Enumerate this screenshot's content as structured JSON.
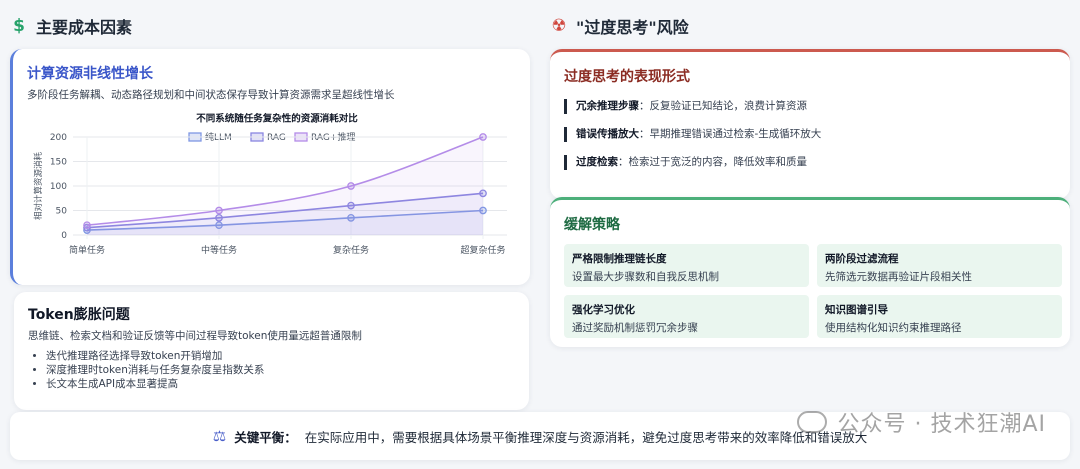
{
  "left": {
    "heading": "主要成本因素",
    "heading_icon": "dollar-icon",
    "compute_card": {
      "title": "计算资源非线性增长",
      "subtitle": "多阶段任务解耦、动态路径规划和中间状态保存导致计算资源需求呈超线性增长"
    },
    "token_card": {
      "title": "Token膨胀问题",
      "subtitle": "思维链、检索文档和验证反馈等中间过程导致token使用量远超普通限制",
      "bullets": [
        "迭代推理路径选择导致token开销增加",
        "深度推理时token消耗与任务复杂度呈指数关系",
        "长文本生成API成本显著提高"
      ]
    }
  },
  "right": {
    "heading": "\"过度思考\"风险",
    "heading_icon": "radiation-icon",
    "risk_card": {
      "title": "过度思考的表现形式",
      "items": [
        {
          "label": "冗余推理步骤",
          "sep": "：",
          "text": "反复验证已知结论，浪费计算资源"
        },
        {
          "label": "错误传播放大",
          "sep": "：",
          "text": "早期推理错误通过检索-生成循环放大"
        },
        {
          "label": "过度检索",
          "sep": "：",
          "text": "检索过于宽泛的内容，降低效率和质量"
        }
      ]
    },
    "mitigation_card": {
      "title": "缓解策略",
      "boxes": [
        {
          "title": "严格限制推理链长度",
          "desc": "设置最大步骤数和自我反思机制"
        },
        {
          "title": "两阶段过滤流程",
          "desc": "先筛选元数据再验证片段相关性"
        },
        {
          "title": "强化学习优化",
          "desc": "通过奖励机制惩罚冗余步骤"
        },
        {
          "title": "知识图谱引导",
          "desc": "使用结构化知识约束推理路径"
        }
      ]
    }
  },
  "bottom": {
    "icon": "balance-scale-icon",
    "label": "关键平衡：",
    "text": "在实际应用中，需要根据具体场景平衡推理深度与资源消耗，避免过度思考带来的效率降低和错误放大"
  },
  "watermark": {
    "text": "公众号 · 技术狂潮AI"
  },
  "colors": {
    "series_llm": "#7f97e3",
    "series_rag": "#8a86e0",
    "series_rag_reason": "#b48ce8"
  },
  "chart_data": {
    "type": "line",
    "title": "不同系统随任务复杂性的资源消耗对比",
    "xlabel": "",
    "ylabel": "相对计算资源消耗",
    "categories": [
      "简单任务",
      "中等任务",
      "复杂任务",
      "超复杂任务"
    ],
    "ylim": [
      0,
      200
    ],
    "yticks": [
      0,
      50,
      100,
      150,
      200
    ],
    "grid": true,
    "legend_position": "top-center",
    "series": [
      {
        "name": "纯LLM",
        "values": [
          10,
          20,
          35,
          50
        ]
      },
      {
        "name": "RAG",
        "values": [
          15,
          35,
          60,
          85
        ]
      },
      {
        "name": "RAG+推理",
        "values": [
          20,
          50,
          100,
          200
        ]
      }
    ]
  }
}
